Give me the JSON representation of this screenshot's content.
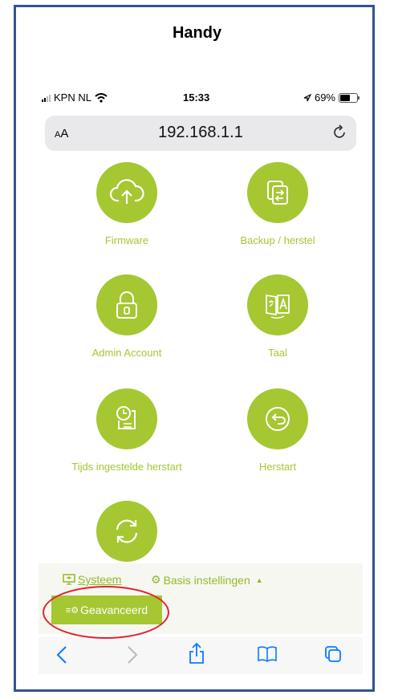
{
  "heading": "Handy",
  "status_bar": {
    "carrier": "KPN NL",
    "time": "15:33",
    "battery": "69%",
    "battery_level": 0.69
  },
  "url_bar": {
    "aa_label": "AA",
    "url": "192.168.1.1"
  },
  "tiles": [
    {
      "label": "Firmware",
      "icon": "cloud-upload-icon"
    },
    {
      "label": "Backup / herstel",
      "icon": "backup-copy-icon"
    },
    {
      "label": "Admin Account",
      "icon": "lock-icon"
    },
    {
      "label": "Taal",
      "icon": "language-book-icon"
    },
    {
      "label": "Tijds ingestelde herstart",
      "icon": "scheduled-restart-icon"
    },
    {
      "label": "Herstart",
      "icon": "restart-arrow-icon"
    },
    {
      "label": "",
      "icon": "refresh-icon"
    }
  ],
  "bottom_nav": {
    "systeem": "Systeem",
    "basis": "Basis instellingen",
    "geavanceerd": "Geavanceerd"
  },
  "colors": {
    "accent": "#a5c732",
    "frame": "#2f5496",
    "highlight": "#e0242b",
    "ios_blue": "#0a7aff"
  }
}
